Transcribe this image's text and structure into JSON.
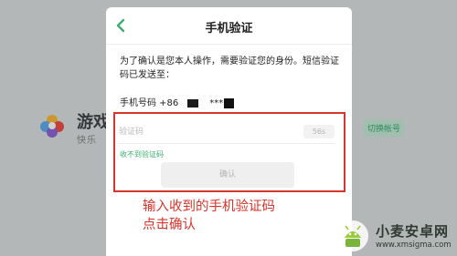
{
  "background": {
    "app_title": "游戏",
    "app_subtitle": "快乐",
    "switch_button": "切换帐号"
  },
  "dialog": {
    "title": "手机验证",
    "description": "为了确认是您本人操作，需要验证您的身份。短信验证码已发送至：",
    "phone_label": "手机号码 +86",
    "phone_masked": "***",
    "code_placeholder": "验证码",
    "countdown": "56s",
    "not_received": "收不到验证码",
    "confirm": "确认"
  },
  "annotation": {
    "line1": "输入收到的手机验证码",
    "line2": "点击确认"
  },
  "watermark": {
    "name": "小麦安卓网",
    "url": "www.xmsigma.com"
  },
  "colors": {
    "accent_green": "#3bb06f",
    "annotation_red": "#d9342b",
    "button_disabled": "#efefef"
  }
}
